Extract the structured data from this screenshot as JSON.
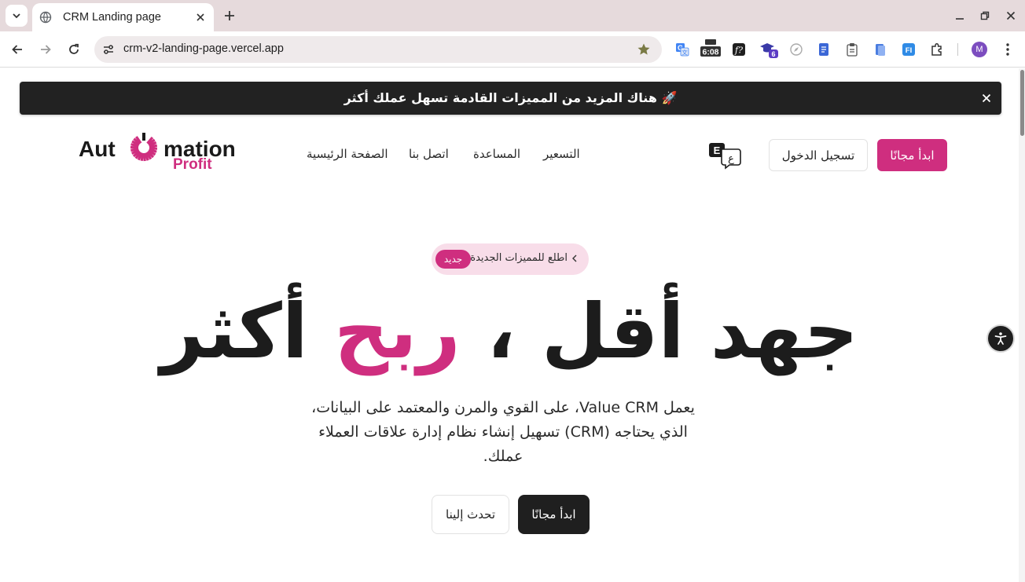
{
  "browser": {
    "tab_title": "CRM Landing page",
    "url": "crm-v2-landing-page.vercel.app",
    "extension_badges": {
      "timer": "6:08",
      "count": "6"
    },
    "profile_initial": "M"
  },
  "announcement": {
    "text": "🚀 هناك المزيد من المميزات القادمة تسهل عملك أكثر"
  },
  "logo": {
    "word_left": "Aut",
    "word_right": "mation",
    "word_bottom": "Profit",
    "accent_color": "#cf2e7f"
  },
  "nav": {
    "items": [
      "التسعير",
      "المساعدة",
      "اتصل بنا",
      "الصفحة الرئيسية"
    ]
  },
  "language_toggle": {
    "latin": "E",
    "arabic": "ع"
  },
  "header_buttons": {
    "login": "تسجيل الدخول",
    "start_free": "ابدأ مجانًا"
  },
  "hero": {
    "pill_text": "اطلع للمميزات الجديدة",
    "pill_badge": "جديد",
    "headline_start": "جهد أقل ، ",
    "headline_accent": "ربح",
    "headline_end": " أكثر",
    "description": "يعمل Value CRM، على القوي والمرن والمعتمد على البيانات، الذي يحتاجه (CRM) تسهيل إنشاء نظام إدارة علاقات العملاء عملك.",
    "cta_primary": "ابدأ مجانًا",
    "cta_secondary": "تحدث إلينا"
  },
  "colors": {
    "brand": "#cf2e7f",
    "dark": "#1f1f1f",
    "pill_bg": "#f8dde9"
  }
}
